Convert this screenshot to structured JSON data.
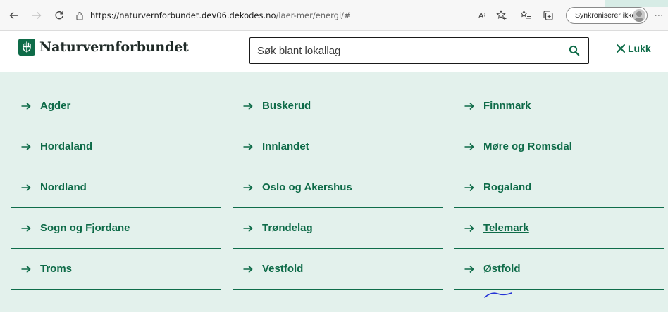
{
  "browser": {
    "url_host": "https://naturvernforbundet.dev06.dekodes.no",
    "url_path": "/laer-mer/energi/#",
    "read_aloud_label": "A⁾",
    "sync_label": "Synkroniserer ikke",
    "more_label": "⋯"
  },
  "site": {
    "logo_text": "Naturvernforbundet",
    "search_placeholder": "Søk blant lokallag",
    "close_label": "Lukk"
  },
  "counties": [
    {
      "label": "Agder"
    },
    {
      "label": "Buskerud"
    },
    {
      "label": "Finnmark"
    },
    {
      "label": "Hordaland"
    },
    {
      "label": "Innlandet"
    },
    {
      "label": "Møre og Romsdal"
    },
    {
      "label": "Nordland"
    },
    {
      "label": "Oslo og Akershus"
    },
    {
      "label": "Rogaland"
    },
    {
      "label": "Sogn og Fjordane"
    },
    {
      "label": "Trøndelag"
    },
    {
      "label": "Telemark",
      "hovered": true
    },
    {
      "label": "Troms"
    },
    {
      "label": "Vestfold"
    },
    {
      "label": "Østfold"
    }
  ],
  "colors": {
    "brand_green": "#0e6b48",
    "panel_bg": "#e3f1ec"
  }
}
